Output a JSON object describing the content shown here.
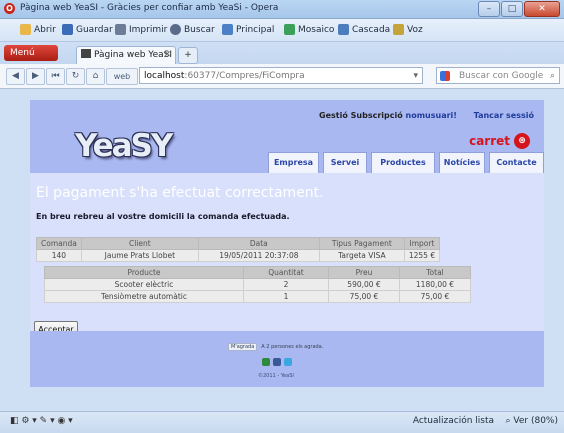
{
  "window": {
    "title": "Pàgina web YeaSI - Gràcies per confiar amb YeaSi - Opera",
    "buttons": [
      "–",
      "□",
      "✕"
    ]
  },
  "menubar": {
    "items": [
      "Abrir",
      "Guardar",
      "Imprimir",
      "Buscar",
      "Principal",
      "Mosaico",
      "Cascada",
      "Voz"
    ]
  },
  "tabs": {
    "menu_label": "Menú",
    "active_tab": "Pàgina web YeaSI - Grà...",
    "close": "✕",
    "new_tab": "+"
  },
  "navbar": {
    "back": "◀",
    "forward": "▶",
    "rewind": "⏮",
    "reload": "↻",
    "home": "⌂",
    "url_prefix": "web",
    "url_host": "localhost",
    "url_path": ":60377/Compres/FiCompra",
    "search_placeholder": "Buscar con Google"
  },
  "site": {
    "user_prefix": "Gestió Subscripció",
    "username": "nomusuari!",
    "logout": "Tancar sessió",
    "logo": "YeaSY",
    "cart": "carret",
    "nav": [
      "Empresa",
      "Servei",
      "Productes",
      "Notícies",
      "Contacte"
    ],
    "success_message": "El pagament s'ha efectuat correctament.",
    "info_message": "En breu rebreu al vostre domicili la comanda efectuada.",
    "order": {
      "headers": [
        "Comanda",
        "Client",
        "Data",
        "Tipus Pagament",
        "Import"
      ],
      "row": [
        "140",
        "Jaume Prats Llobet",
        "19/05/2011 20:37:08",
        "Targeta VISA",
        "1255 €"
      ]
    },
    "products": {
      "headers": [
        "Producte",
        "Quantitat",
        "Preu",
        "Total"
      ],
      "rows": [
        [
          "Scooter elèctric",
          "2",
          "590,00 €",
          "1180,00 €"
        ],
        [
          "Tensiòmetre automàtic",
          "1",
          "75,00 €",
          "75,00 €"
        ]
      ]
    },
    "accept_button": "Acceptar",
    "footer": {
      "like": "M'agrada",
      "like_count": "A 2 persones els agrada.",
      "copyright": "©2011 - YeaSI"
    }
  },
  "statusbar": {
    "left": "◧  ⚙ ▾  ✎ ▾  ◉ ▾",
    "update": "Actualización lista",
    "zoom": "Ver (80%)"
  }
}
